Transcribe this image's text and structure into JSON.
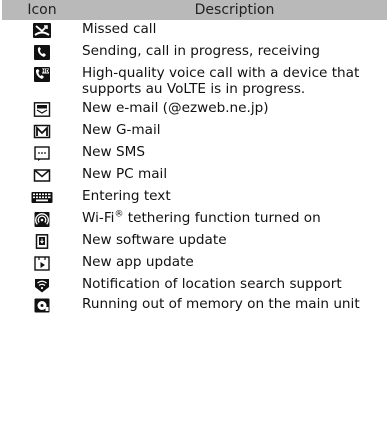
{
  "header": {
    "icon": "Icon",
    "description": "Description"
  },
  "rows": [
    {
      "icon": "missed-call-icon",
      "description": "Missed call"
    },
    {
      "icon": "phone-call-icon",
      "description": "Sending, call in progress, receiving"
    },
    {
      "icon": "hd-call-icon",
      "description": "High-quality voice call with a device that supports au VoLTE is in progress."
    },
    {
      "icon": "ezweb-mail-icon",
      "description": "New e-mail (@ezweb.ne.jp)"
    },
    {
      "icon": "gmail-icon",
      "description": "New G-mail"
    },
    {
      "icon": "sms-icon",
      "description": "New SMS"
    },
    {
      "icon": "pc-mail-icon",
      "description": "New PC mail"
    },
    {
      "icon": "keyboard-icon",
      "description": "Entering text"
    },
    {
      "icon": "wifi-tethering-icon",
      "description_main": "Wi-Fi",
      "description_sup": "®",
      "description_rest": " tethering function turned on"
    },
    {
      "icon": "software-update-icon",
      "description": "New software update"
    },
    {
      "icon": "app-update-icon",
      "description": "New app update"
    },
    {
      "icon": "location-search-icon",
      "description": "Notification of location search support"
    },
    {
      "icon": "low-memory-icon",
      "description": "Running out of memory on the main unit"
    }
  ]
}
